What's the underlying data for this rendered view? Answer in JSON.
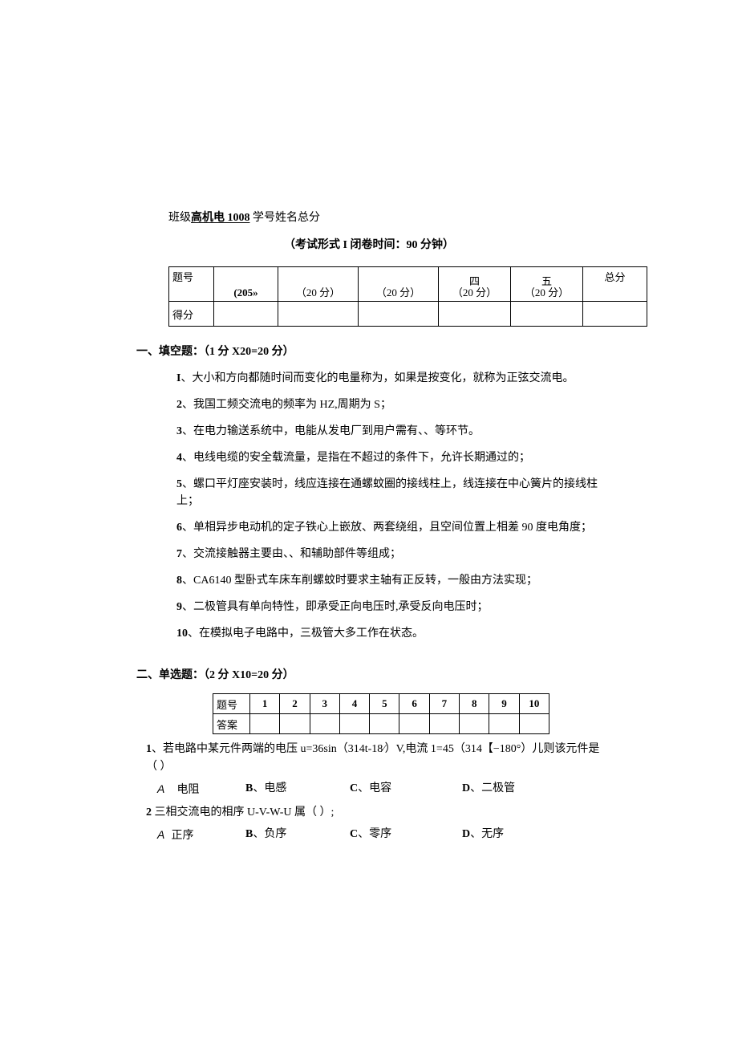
{
  "header": {
    "class_prefix": "班级",
    "class_value": "高机电 1008",
    "id_suffix": " 学号姓名总分",
    "exam_form": "（考试形式 I 闭卷时间：90 分钟）"
  },
  "score_table": {
    "row_label_num": "题号",
    "row_label_score": "得分",
    "cells": [
      "(205»",
      "（20 分）",
      "（20 分）",
      "（20 分）",
      "（20 分）",
      ""
    ],
    "cells_top": [
      "",
      "",
      "",
      "四",
      "五",
      "总分"
    ]
  },
  "section1": {
    "heading": "一、填空题：（1 分 X20=20 分）",
    "items": [
      {
        "n": "I",
        "t": "、大小和方向都随时间而变化的电量称为，如果是按变化，就称为正弦交流电。"
      },
      {
        "n": "2",
        "t": "、我国工频交流电的频率为 HZ,周期为 S；"
      },
      {
        "n": "3",
        "t": "、在电力输送系统中，电能从发电厂到用户需有、、等环节。"
      },
      {
        "n": "4",
        "t": "、电线电缆的安全载流量，是指在不超过的条件下，允许长期通过的；"
      },
      {
        "n": "5",
        "t": "、螺口平灯座安装时，线应连接在通螺蚊圈的接线柱上，线连接在中心簧片的接线柱上；"
      },
      {
        "n": "6",
        "t": "、单相异步电动机的定子铁心上嵌放、两套绕组，且空间位置上相差 90 度电角度；"
      },
      {
        "n": "7",
        "t": "、交流接触器主要由、、和辅助部件等组成；"
      },
      {
        "n": "8",
        "t": "、CA6140 型卧式车床车削螺蚊时要求主轴有正反转，一般由方法实现；"
      },
      {
        "n": "9",
        "t": "、二极管具有单向特性，即承受正向电压时,承受反向电压时；"
      },
      {
        "n": "10",
        "t": "、在模拟电子电路中，三极管大多工作在状态。"
      }
    ]
  },
  "section2": {
    "heading": "二、单选题：（2 分 X10=20 分）",
    "table": {
      "row_num": "题号",
      "row_ans": "答案",
      "nums": [
        "1",
        "2",
        "3",
        "4",
        "5",
        "6",
        "7",
        "8",
        "9",
        "10"
      ]
    },
    "q1": {
      "lead_num": "1",
      "lead": "、若电路中某元件两端的电压 u=36sin（314t-18⁄）V,电流 1=45（314【−180°）儿则该元件是（   ）",
      "a_key": "A",
      "opts": {
        "a": "电阻",
        "b": "B、电感",
        "c": "C、电容",
        "d": "D、二极管"
      }
    },
    "q2": {
      "lead_num": "2",
      "lead": "  三相交流电的相序 U-V-W-U 属（   ）;",
      "a_key": "A",
      "opts": {
        "a": "正序",
        "b": "B、负序",
        "c": "C、零序",
        "d": "D、无序"
      }
    }
  }
}
